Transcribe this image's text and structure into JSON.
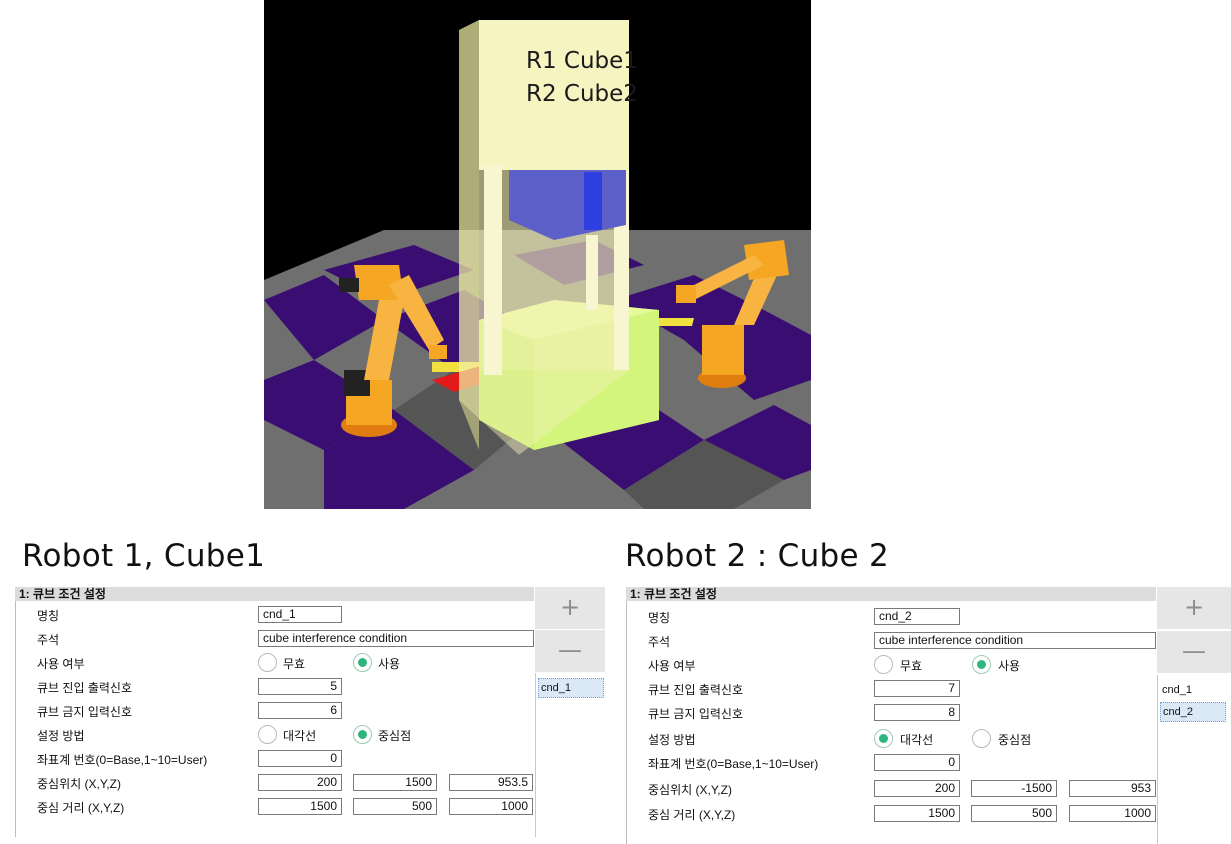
{
  "scene": {
    "label_line1": "R1 Cube1",
    "label_line2": "R2 Cube2",
    "colors": {
      "background": "#000000",
      "floor_dark": "#3a0d72",
      "floor_light": "#7a7a7a",
      "cube_outer": "#f3f2b7",
      "cube_inner": "#c9f06b",
      "robot": "#f5a623",
      "target_pad": "#e21a1a"
    }
  },
  "panels": [
    {
      "heading": "Robot 1, Cube1",
      "header": "1: 큐브 조건 설정",
      "labels": {
        "name": "명칭",
        "comment": "주석",
        "use": "사용 여부",
        "out_signal": "큐브 진입 출력신호",
        "in_signal": "큐브 금지 입력신호",
        "method": "설정 방법",
        "coord": "좌표계 번호(0=Base,1~10=User)",
        "center": "중심위치 (X,Y,Z)",
        "distance": "중심 거리 (X,Y,Z)"
      },
      "values": {
        "name": "cnd_1",
        "comment": "cube interference condition",
        "out_signal": "5",
        "in_signal": "6",
        "coord": "0",
        "center_x": "200",
        "center_y": "1500",
        "center_z": "953.5",
        "dist_x": "1500",
        "dist_y": "500",
        "dist_z": "1000"
      },
      "use_options": [
        "무효",
        "사용"
      ],
      "use_selected": "사용",
      "method_options": [
        "대각선",
        "중심점"
      ],
      "method_selected": "중심점",
      "add_button": "+",
      "remove_button": "—",
      "list": [
        "cnd_1"
      ],
      "list_selected": "cnd_1"
    },
    {
      "heading": "Robot 2 : Cube 2",
      "header": "1: 큐브 조건 설정",
      "labels": {
        "name": "명칭",
        "comment": "주석",
        "use": "사용 여부",
        "out_signal": "큐브 진입 출력신호",
        "in_signal": "큐브 금지 입력신호",
        "method": "설정 방법",
        "coord": "좌표계 번호(0=Base,1~10=User)",
        "center": "중심위치 (X,Y,Z)",
        "distance": "중심 거리 (X,Y,Z)"
      },
      "values": {
        "name": "cnd_2",
        "comment": "cube interference condition",
        "out_signal": "7",
        "in_signal": "8",
        "coord": "0",
        "center_x": "200",
        "center_y": "-1500",
        "center_z": "953",
        "dist_x": "1500",
        "dist_y": "500",
        "dist_z": "1000"
      },
      "use_options": [
        "무효",
        "사용"
      ],
      "use_selected": "사용",
      "method_options": [
        "대각선",
        "중심점"
      ],
      "method_selected": "대각선",
      "add_button": "+",
      "remove_button": "—",
      "list": [
        "cnd_1",
        "cnd_2"
      ],
      "list_selected": "cnd_2"
    }
  ]
}
